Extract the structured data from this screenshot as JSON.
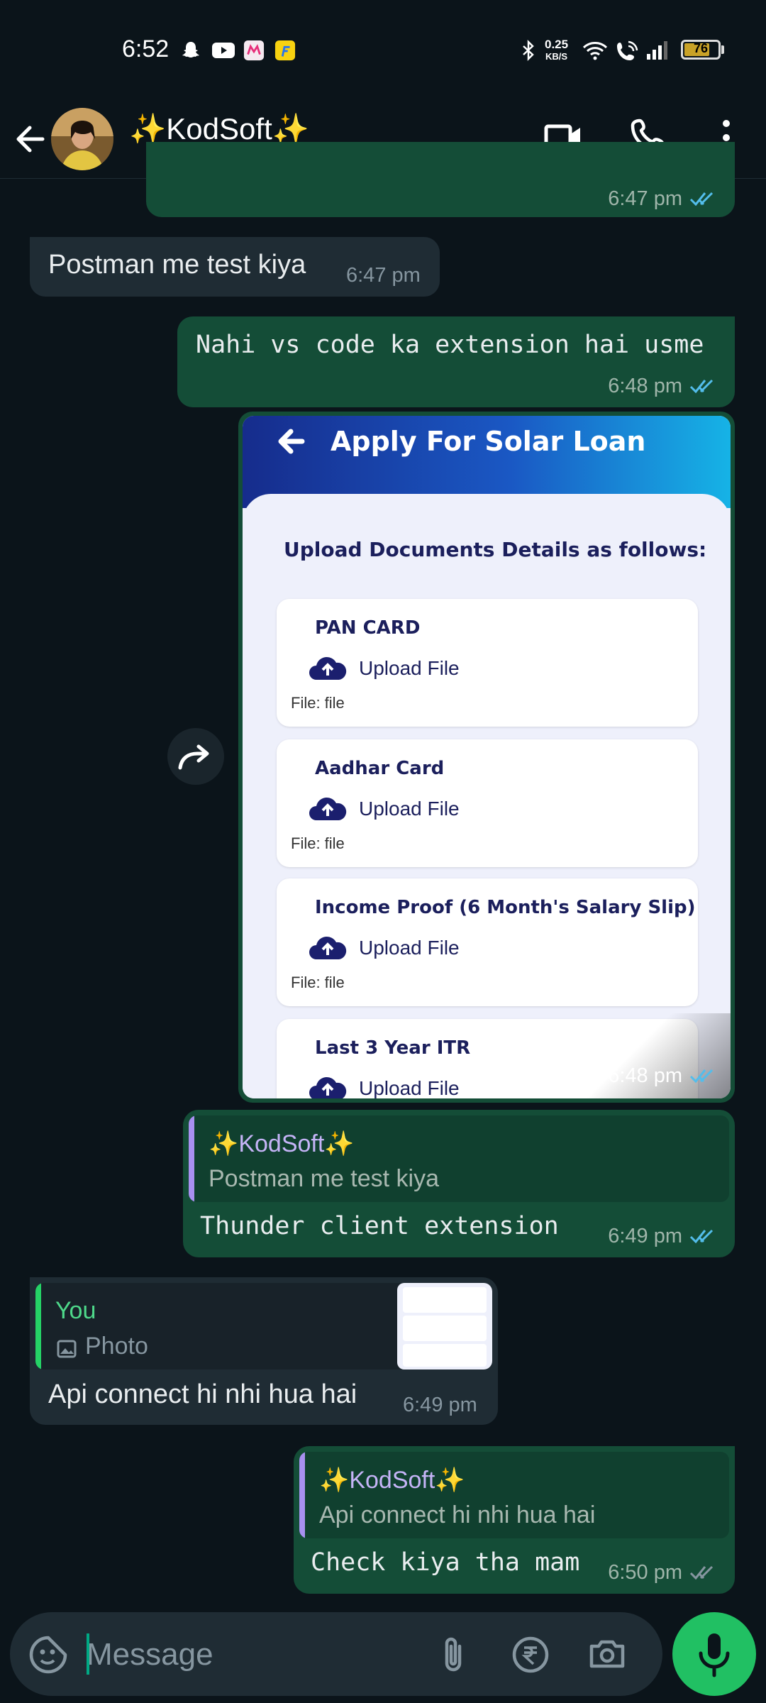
{
  "status_bar": {
    "time": "6:52",
    "net_speed_value": "0.25",
    "net_speed_unit": "KB/S",
    "battery": "76",
    "battery_level": 0.76
  },
  "header": {
    "contact_name": "✨KodSoft✨",
    "icons": [
      "back-arrow-icon",
      "video-call-icon",
      "voice-call-icon",
      "more-options-icon"
    ]
  },
  "messages": [
    {
      "id": "m0",
      "direction": "out",
      "time": "6:47 pm"
    },
    {
      "id": "m1",
      "direction": "in",
      "text": "Postman me test kiya",
      "time": "6:47 pm"
    },
    {
      "id": "m2",
      "direction": "out",
      "text": "Nahi vs code ka extension hai usme",
      "time": "6:48 pm"
    },
    {
      "id": "m3",
      "direction": "out",
      "type": "image",
      "time": "6:48 pm",
      "image": {
        "title": "Apply For Solar Loan",
        "heading": "Upload Documents Details as follows:",
        "docs": [
          {
            "title": "PAN CARD",
            "upload": "Upload File",
            "file": "File: file"
          },
          {
            "title": "Aadhar Card",
            "upload": "Upload File",
            "file": "File: file"
          },
          {
            "title": "Income Proof (6 Month's Salary Slip)",
            "upload": "Upload File",
            "file": "File: file"
          },
          {
            "title": "Last 3 Year ITR",
            "upload": "Upload File",
            "file": ""
          }
        ]
      }
    },
    {
      "id": "m4",
      "direction": "out",
      "time": "6:49 pm",
      "reply_to": {
        "name": "✨KodSoft✨",
        "text": "Postman me test kiya"
      },
      "text": "Thunder client extension"
    },
    {
      "id": "m5",
      "direction": "in",
      "time": "6:49 pm",
      "reply_to": {
        "name": "You",
        "text": "Photo"
      },
      "text": "Api connect hi nhi hua hai"
    },
    {
      "id": "m6",
      "direction": "out",
      "time": "6:50 pm",
      "reply_to": {
        "name": "✨KodSoft✨",
        "text": "Api connect hi nhi hua hai"
      },
      "text": "Check kiya tha mam"
    }
  ],
  "input": {
    "placeholder": "Message"
  },
  "colors": {
    "background": "#0b141a",
    "outgoing_bubble": "#144d37",
    "incoming_bubble": "#1f2c34",
    "read_ticks": "#53bdeb",
    "accent_green": "#21c063"
  }
}
